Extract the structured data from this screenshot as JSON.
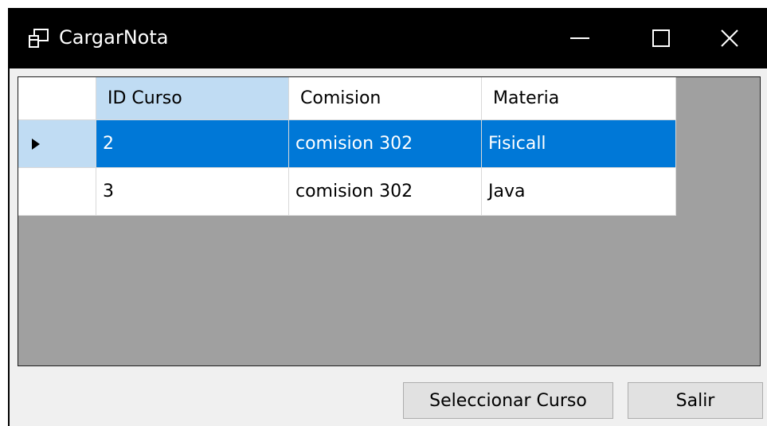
{
  "window": {
    "title": "CargarNota"
  },
  "grid": {
    "columns": [
      "ID Curso",
      "Comision",
      "Materia"
    ],
    "rows": [
      {
        "id": "2",
        "comision": "comision 302",
        "materia": "Fisicall",
        "selected": true
      },
      {
        "id": "3",
        "comision": "comision 302",
        "materia": "Java",
        "selected": false
      }
    ]
  },
  "buttons": {
    "select_label": "Seleccionar Curso",
    "exit_label": "Salir"
  },
  "colors": {
    "selection": "#0078d7",
    "header_highlight": "#c0dcf3",
    "grid_background": "#a0a0a0"
  }
}
